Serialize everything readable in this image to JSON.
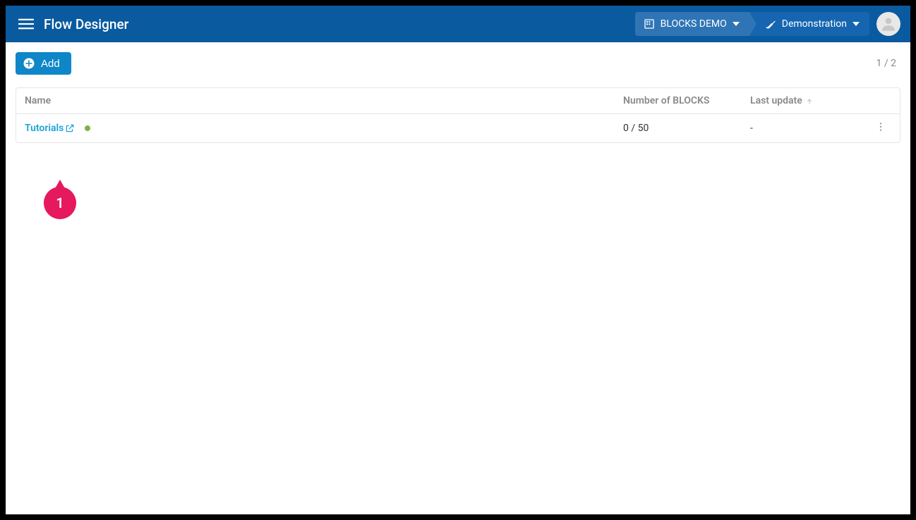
{
  "header": {
    "app_title": "Flow Designer",
    "org_label": "BLOCKS DEMO",
    "project_label": "Demonstration"
  },
  "toolbar": {
    "add_label": "Add",
    "page_indicator": "1 / 2"
  },
  "table": {
    "columns": {
      "name": "Name",
      "blocks": "Number of BLOCKS",
      "update": "Last update"
    },
    "rows": [
      {
        "name": "Tutorials",
        "blocks": "0 / 50",
        "update": "-"
      }
    ]
  },
  "callout": {
    "label": "1"
  }
}
